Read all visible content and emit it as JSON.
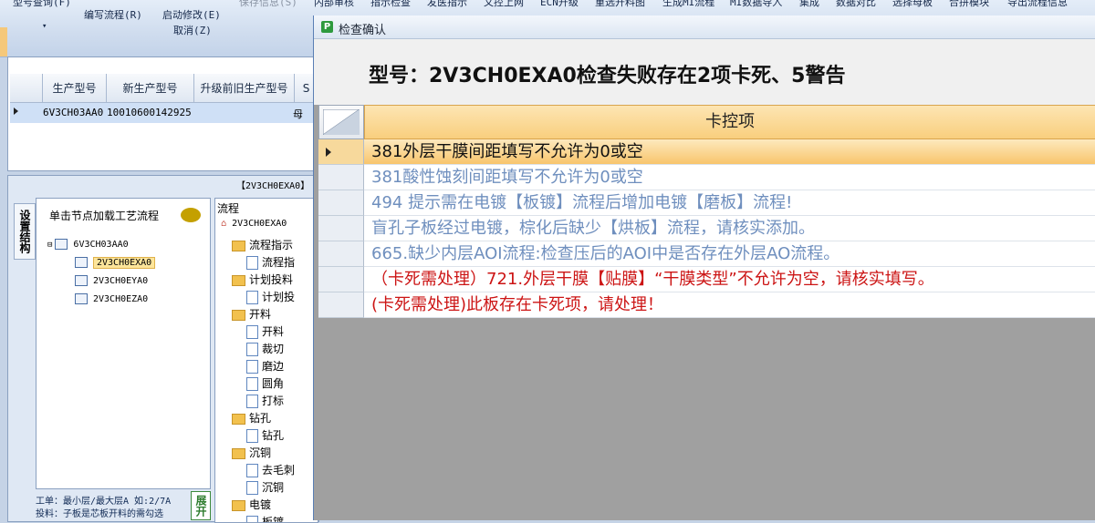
{
  "ribbon": {
    "top_left": "型号查询(F)",
    "edit_flow": "编写流程(R)",
    "start_modify": "启动修改(E)",
    "cancel": "取消(Z)",
    "save_info": "保存信息(S)",
    "tabs": [
      "内部审核",
      "指示检查",
      "发医指示",
      "文控上网",
      "ECN升级",
      "重选开料图",
      "生成MI流程",
      "MI数据导入",
      "集成",
      "数据对比",
      "选择母板",
      "合拼模块",
      "导出流程信息"
    ]
  },
  "grid": {
    "headers": [
      "生产型号",
      "新生产型号",
      "升级前旧生产型号",
      "S"
    ],
    "row": {
      "model": "6V3CH03AA0",
      "new_model": "10010600142925",
      "extra": "母"
    }
  },
  "tree_panel": {
    "tab_caption": "【2V3CH0EXA0】",
    "vertical_tab": "设置结构",
    "hint": "单击节点加载工艺流程",
    "root": "6V3CH03AA0",
    "children": [
      "2V3CH0EXA0",
      "2V3CH0EYA0",
      "2V3CH0EZA0"
    ],
    "footer_line1": "工单：最小层/最大层A 如:2/7A",
    "footer_line2": "投料：子板是芯板开料的需勾选",
    "expand_button": "展开"
  },
  "flow_panel": {
    "title": "流程",
    "root": "2V3CH0EXA0",
    "nodes": [
      {
        "type": "folder",
        "label": "流程指示"
      },
      {
        "type": "doc",
        "label": "流程指"
      },
      {
        "type": "folder",
        "label": "计划投料"
      },
      {
        "type": "doc",
        "label": "计划投"
      },
      {
        "type": "folder",
        "label": "开料"
      },
      {
        "type": "doc",
        "label": "开料"
      },
      {
        "type": "doc",
        "label": "裁切"
      },
      {
        "type": "doc",
        "label": "磨边"
      },
      {
        "type": "doc",
        "label": "圆角"
      },
      {
        "type": "doc",
        "label": "打标"
      },
      {
        "type": "folder",
        "label": "钻孔"
      },
      {
        "type": "doc",
        "label": "钻孔"
      },
      {
        "type": "folder",
        "label": "沉铜"
      },
      {
        "type": "doc",
        "label": "去毛刺"
      },
      {
        "type": "doc",
        "label": "沉铜"
      },
      {
        "type": "folder",
        "label": "电镀"
      },
      {
        "type": "doc",
        "label": "板镀"
      }
    ]
  },
  "dialog": {
    "title": "检查确认",
    "heading": "型号：2V3CH0EXA0检查失败存在2项卡死、5警告",
    "column_header": "卡控项",
    "rows": [
      {
        "text": "381外层干膜间距填写不允许为0或空",
        "style": "cur"
      },
      {
        "text": "381酸性蚀刻间距填写不允许为0或空",
        "style": "blue"
      },
      {
        "text": "494 提示需在电镀【板镀】流程后增加电镀【磨板】流程!",
        "style": "blue"
      },
      {
        "text": "盲孔子板经过电镀，棕化后缺少【烘板】流程，请核实添加。",
        "style": "blue"
      },
      {
        "text": "665.缺少内层AOI流程:检查压后的AOI中是否存在外层AO流程。",
        "style": "blue"
      },
      {
        "text": "（卡死需处理）721.外层干膜【贴膜】“干膜类型”不允许为空，请核实填写。",
        "style": "red"
      },
      {
        "text": "(卡死需处理)此板存在卡死项，请处理！",
        "style": "red"
      }
    ]
  },
  "colors": {
    "selected_row": "#f8c56c",
    "warning_text": "#6f8fbe",
    "blocking_text": "#cc1414",
    "header_bg": "#f9cf7e"
  }
}
